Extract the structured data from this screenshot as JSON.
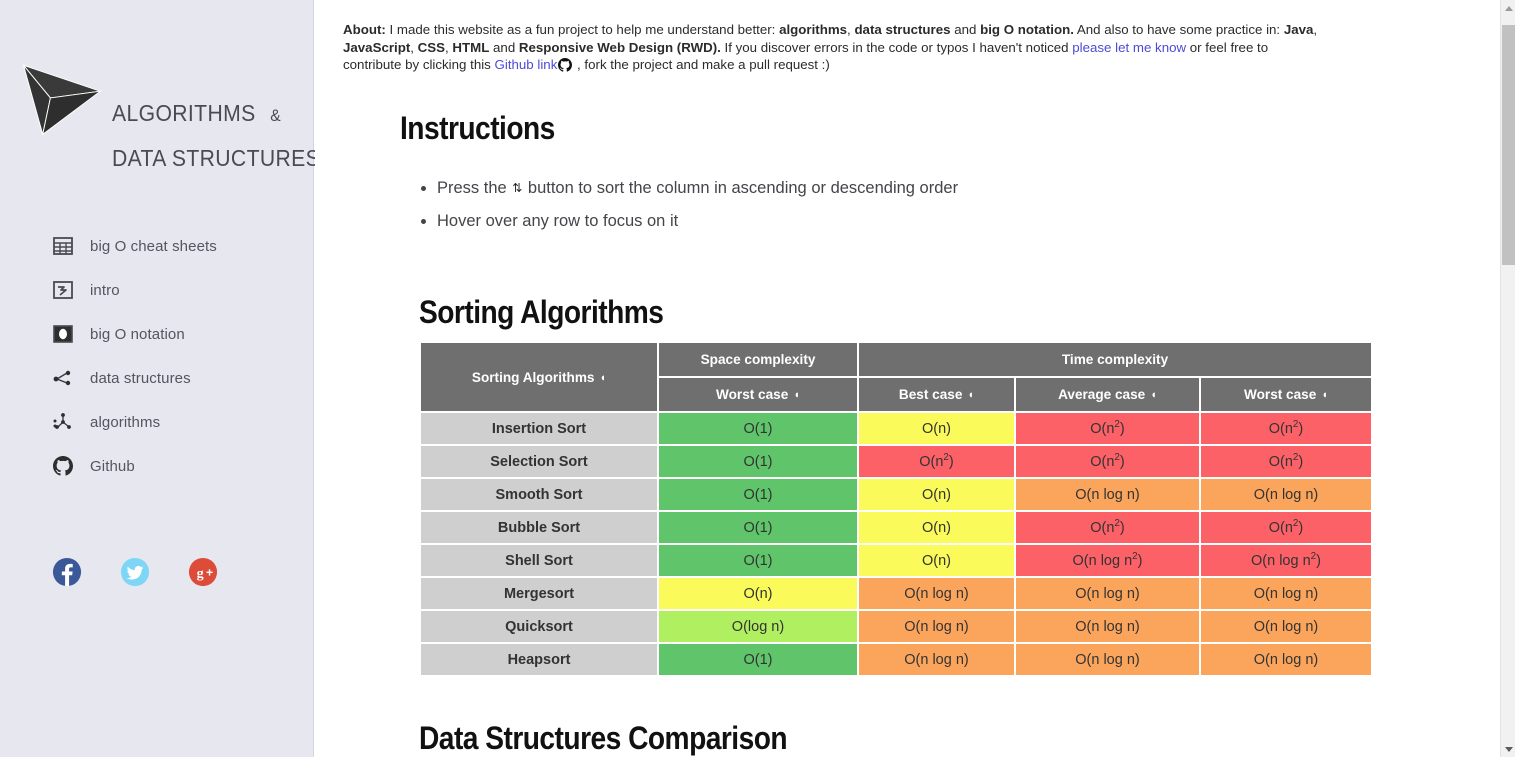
{
  "sidebar": {
    "brand": {
      "line1": "ALGORITHMS",
      "amp": "&",
      "line2": "DATA STRUCTURES",
      "logo_icon": "triangle-arrow-logo-icon"
    },
    "items": [
      {
        "label": "big O cheat sheets",
        "icon": "grid-table-icon"
      },
      {
        "label": "intro",
        "icon": "enter-arrow-icon"
      },
      {
        "label": "big O notation",
        "icon": "big-o-square-icon"
      },
      {
        "label": "data structures",
        "icon": "node-link-icon"
      },
      {
        "label": "algorithms",
        "icon": "graph-nodes-icon"
      },
      {
        "label": "Github",
        "icon": "github-icon"
      }
    ],
    "social": [
      {
        "name": "facebook-icon",
        "label": "f",
        "color": "#3b5998"
      },
      {
        "name": "twitter-icon",
        "label": "t",
        "color": "#7ed6f7"
      },
      {
        "name": "google-plus-icon",
        "label": "g+",
        "color": "#dd4b39"
      }
    ]
  },
  "about": {
    "label": "About:",
    "text_1": " I made this website as a fun project to help me understand better: ",
    "b_algorithms": "algorithms",
    "sep_1": ", ",
    "b_data_structures": "data structures",
    "sep_2": " and ",
    "b_bigo": "big O notation.",
    "text_2": " And also to have some practice in: ",
    "b_java": "Java",
    "sep_3": ", ",
    "b_javascript": "JavaScript",
    "sep_4": ", ",
    "b_css": "CSS",
    "sep_5": ", ",
    "b_html": "HTML",
    "sep_6": " and ",
    "b_rwd": "Responsive Web Design (RWD).",
    "text_3": " If you discover errors in the code or typos I haven't noticed ",
    "link_let_me_know": "please let me know",
    "text_4": " or feel free to contribute by clicking this ",
    "link_github": "Github link",
    "github_icon": "github-icon",
    "text_5": " , fork the project and make a pull request :)"
  },
  "instructions": {
    "title": "Instructions",
    "bullet_1_pre": "Press the",
    "sort_glyph": "⇅",
    "bullet_1_post": "button to sort the column in ascending or descending order",
    "bullet_2": "Hover over any row to focus on it"
  },
  "sorting": {
    "title": "Sorting Algorithms",
    "headers": {
      "row_head": "Sorting Algorithms",
      "space_group": "Space complexity",
      "time_group": "Time complexity",
      "space_worst": "Worst case",
      "time_best": "Best case",
      "time_avg": "Average case",
      "time_worst": "Worst case",
      "sort_icon": "sort-toggle-icon"
    },
    "rows": [
      {
        "name": "Insertion Sort",
        "space_worst": {
          "text": "O(1)",
          "class": "c-green"
        },
        "best": {
          "text": "O(n)",
          "class": "c-yellow"
        },
        "average": {
          "text": "O(n²)",
          "class": "c-red"
        },
        "worst": {
          "text": "O(n²)",
          "class": "c-red"
        }
      },
      {
        "name": "Selection Sort",
        "space_worst": {
          "text": "O(1)",
          "class": "c-green"
        },
        "best": {
          "text": "O(n²)",
          "class": "c-red"
        },
        "average": {
          "text": "O(n²)",
          "class": "c-red"
        },
        "worst": {
          "text": "O(n²)",
          "class": "c-red"
        }
      },
      {
        "name": "Smooth Sort",
        "space_worst": {
          "text": "O(1)",
          "class": "c-green"
        },
        "best": {
          "text": "O(n)",
          "class": "c-yellow"
        },
        "average": {
          "text": "O(n log n)",
          "class": "c-orange"
        },
        "worst": {
          "text": "O(n log n)",
          "class": "c-orange"
        }
      },
      {
        "name": "Bubble Sort",
        "space_worst": {
          "text": "O(1)",
          "class": "c-green"
        },
        "best": {
          "text": "O(n)",
          "class": "c-yellow"
        },
        "average": {
          "text": "O(n²)",
          "class": "c-red"
        },
        "worst": {
          "text": "O(n²)",
          "class": "c-red"
        }
      },
      {
        "name": "Shell Sort",
        "space_worst": {
          "text": "O(1)",
          "class": "c-green"
        },
        "best": {
          "text": "O(n)",
          "class": "c-yellow"
        },
        "average": {
          "text": "O(n log n²)",
          "class": "c-red"
        },
        "worst": {
          "text": "O(n log n²)",
          "class": "c-red"
        }
      },
      {
        "name": "Mergesort",
        "space_worst": {
          "text": "O(n)",
          "class": "c-yellow"
        },
        "best": {
          "text": "O(n log n)",
          "class": "c-orange"
        },
        "average": {
          "text": "O(n log n)",
          "class": "c-orange"
        },
        "worst": {
          "text": "O(n log n)",
          "class": "c-orange"
        }
      },
      {
        "name": "Quicksort",
        "space_worst": {
          "text": "O(log n)",
          "class": "c-ltgrn"
        },
        "best": {
          "text": "O(n log n)",
          "class": "c-orange"
        },
        "average": {
          "text": "O(n log n)",
          "class": "c-orange"
        },
        "worst": {
          "text": "O(n log n)",
          "class": "c-orange"
        }
      },
      {
        "name": "Heapsort",
        "space_worst": {
          "text": "O(1)",
          "class": "c-green"
        },
        "best": {
          "text": "O(n log n)",
          "class": "c-orange"
        },
        "average": {
          "text": "O(n log n)",
          "class": "c-orange"
        },
        "worst": {
          "text": "O(n log n)",
          "class": "c-orange"
        }
      }
    ]
  },
  "data_structures": {
    "title": "Data Structures Comparison"
  },
  "scrollbar": {
    "up": "scroll-up-arrow-icon",
    "down": "scroll-down-arrow-icon",
    "thumb": "scrollbar-thumb"
  },
  "colors": {
    "sidebar_bg": "#e7e7f0",
    "header_gray": "#6f6f6f",
    "row_gray": "#cfcfcf",
    "green": "#5fc46a",
    "light_green": "#b0ef60",
    "yellow": "#fafa5a",
    "orange": "#fba55c",
    "red": "#fb6166",
    "link_blue": "#4b4bd8"
  }
}
